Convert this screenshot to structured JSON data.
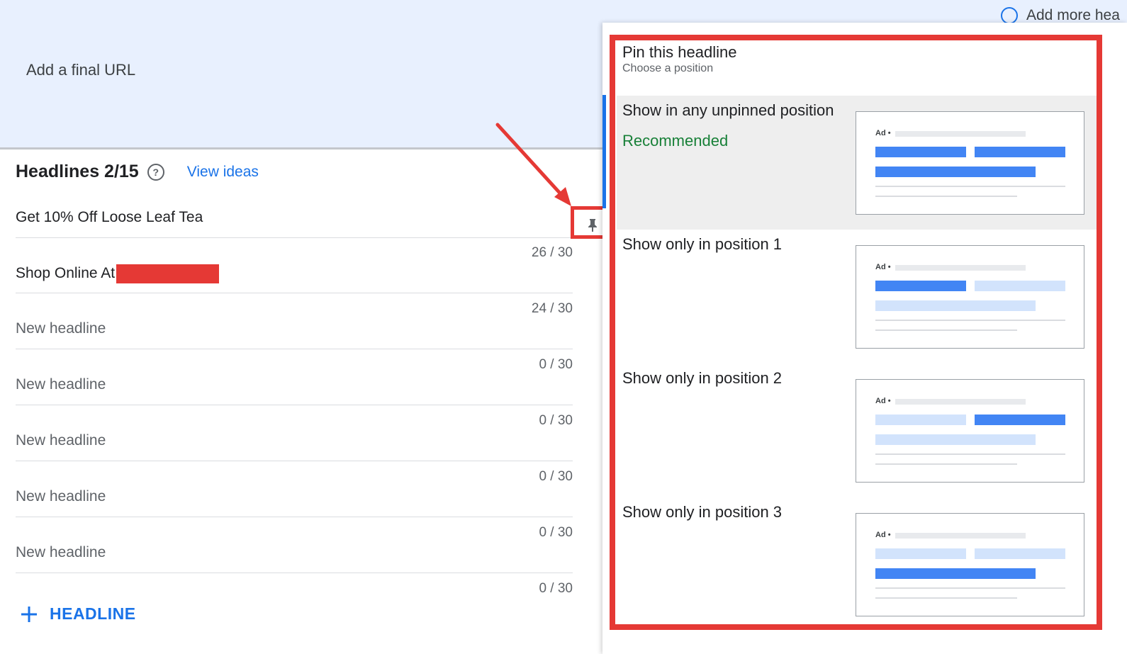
{
  "top": {
    "final_url_label": "Add a final URL",
    "add_more_label": "Add more hea"
  },
  "headlines": {
    "title": "Headlines 2/15",
    "view_ideas": "View ideas",
    "rows": [
      {
        "text": "Get 10% Off Loose Leaf Tea",
        "counter": "26 / 30"
      },
      {
        "text": "Shop Online At",
        "counter": "24 / 30",
        "redacted": true
      },
      {
        "placeholder": "New headline",
        "counter": "0 / 30"
      },
      {
        "placeholder": "New headline",
        "counter": "0 / 30"
      },
      {
        "placeholder": "New headline",
        "counter": "0 / 30"
      },
      {
        "placeholder": "New headline",
        "counter": "0 / 30"
      },
      {
        "placeholder": "New headline",
        "counter": "0 / 30"
      }
    ],
    "add_button": "HEADLINE"
  },
  "pin_panel": {
    "title": "Pin this headline",
    "subtitle": "Choose a position",
    "options": [
      {
        "label": "Show in any unpinned position",
        "note": "Recommended",
        "selected": true,
        "preview": [
          true,
          true,
          true
        ]
      },
      {
        "label": "Show only in position 1",
        "selected": false,
        "preview": [
          true,
          false,
          false
        ]
      },
      {
        "label": "Show only in position 2",
        "selected": false,
        "preview": [
          false,
          true,
          false
        ]
      },
      {
        "label": "Show only in position 3",
        "selected": false,
        "preview": [
          false,
          false,
          true
        ]
      }
    ],
    "preview_ad_label": "Ad •"
  },
  "colors": {
    "accent": "#1a73e8",
    "annotation": "#e53935",
    "recommended": "#188038"
  },
  "icons": [
    "help-icon",
    "pin-icon",
    "plus-icon",
    "radio-icon"
  ]
}
